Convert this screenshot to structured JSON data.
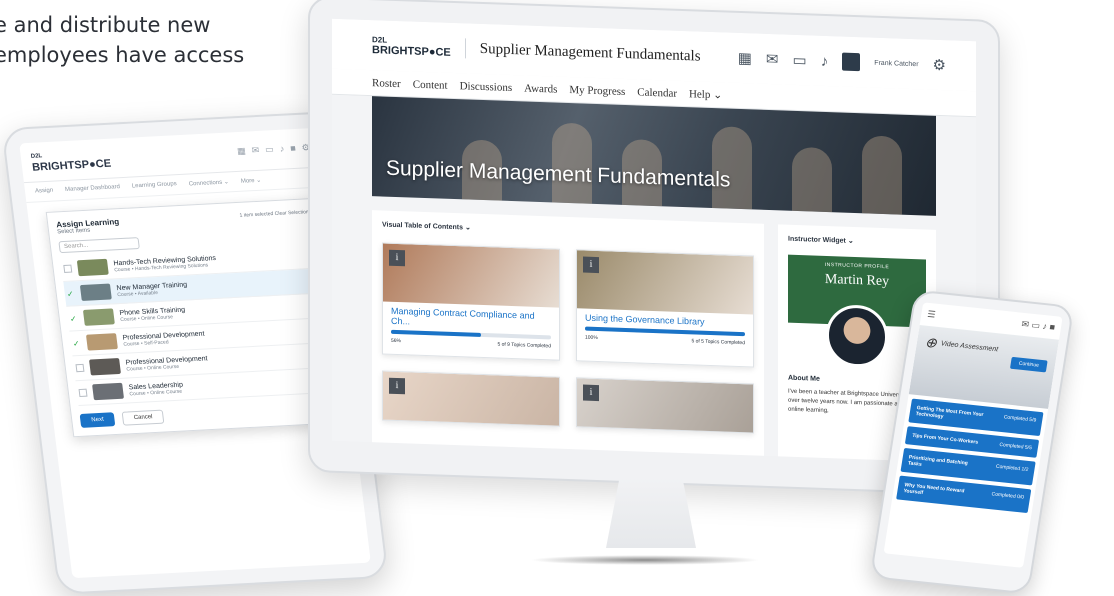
{
  "copy": {
    "line1": "e and distribute new",
    "line2": "employees have access"
  },
  "monitor": {
    "brand_top": "D2L",
    "brand_bottom": "BRIGHTSP●CE",
    "course_title": "Supplier Management Fundamentals",
    "user_name": "Frank Catcher",
    "nav": [
      "Roster",
      "Content",
      "Discussions",
      "Awards",
      "My Progress",
      "Calendar",
      "Help ⌄"
    ],
    "banner_title": "Supplier Management Fundamentals",
    "vtoc_title": "Visual Table of Contents ⌄",
    "cards": [
      {
        "title": "Managing Contract Compliance and Ch...",
        "percent": "56%",
        "progress": 0.56,
        "topics": "5 of 9 Topics Completed",
        "color": "#b07a5a"
      },
      {
        "title": "Using the Governance Library",
        "percent": "100%",
        "progress": 1.0,
        "topics": "5 of 5 Topics Completed",
        "color": "#9a8a6a"
      }
    ],
    "widget_title": "Instructor Widget ⌄",
    "profile_label": "INSTRUCTOR PROFILE",
    "instructor_name": "Martin Rey",
    "about_heading": "About Me",
    "about_text": "I've been a teacher at Brightspace University for over twelve years now. I am passionate about online learning,"
  },
  "tablet": {
    "brand_top": "D2L",
    "brand_bottom": "BRIGHTSP●CE",
    "nav": [
      "Assign",
      "Manager Dashboard",
      "Learning Groups",
      "Connections ⌄",
      "More ⌄"
    ],
    "panel_title": "Assign Learning",
    "panel_sub": "Select Items",
    "selected_info": "1 item selected  Clear Selection",
    "search_placeholder": "Search...",
    "rows": [
      {
        "name": "Hands-Tech Reviewing Solutions",
        "meta": "Course • Hands-Tech Reviewing Solutions",
        "checked": false,
        "active": false
      },
      {
        "name": "New Manager Training",
        "meta": "Course • Available",
        "checked": true,
        "active": true
      },
      {
        "name": "Phone Skills Training",
        "meta": "Course • Online Course",
        "checked": true,
        "active": false
      },
      {
        "name": "Professional Development",
        "meta": "Course • Self-Paced",
        "checked": true,
        "active": false
      },
      {
        "name": "Professional Development",
        "meta": "Course • Online Course",
        "checked": false,
        "active": false
      },
      {
        "name": "Sales Leadership",
        "meta": "Course • Online Course",
        "checked": false,
        "active": false
      }
    ],
    "next_label": "Next",
    "cancel_label": "Cancel"
  },
  "phone": {
    "title": "Video Assessment",
    "continue_label": "Continue",
    "items": [
      {
        "title": "Getting The Most From Your Technology",
        "status": "Completed 5/9"
      },
      {
        "title": "Tips From Your Co-Workers",
        "status": "Completed 5/5"
      },
      {
        "title": "Prioritizing and Batching Tasks",
        "status": "Completed 1/2"
      },
      {
        "title": "Why You Need to Reward Yourself",
        "status": "Completed 0/0"
      }
    ]
  }
}
